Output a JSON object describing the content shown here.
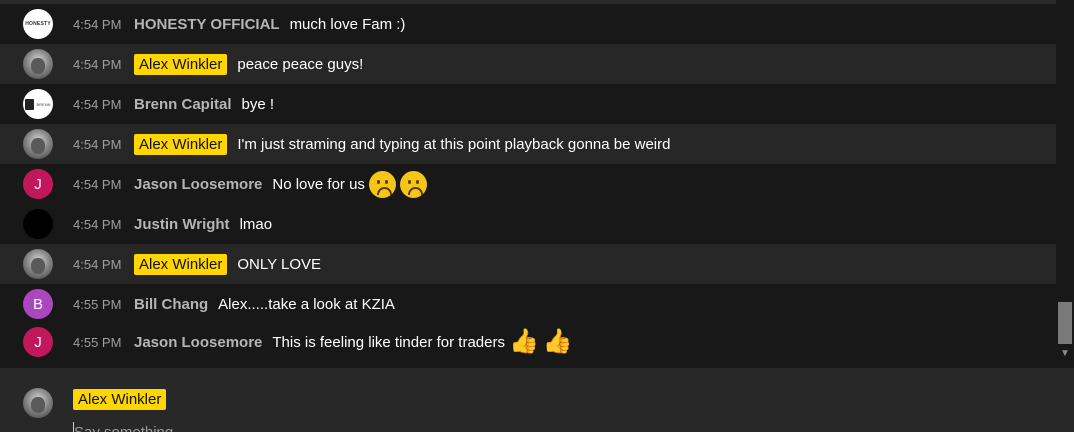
{
  "messages": [
    {
      "time": "4:54 PM",
      "author": "HONESTY OFFICIAL",
      "text": "much love Fam :)",
      "avatar": "honesty-logo",
      "owner": false,
      "emojis": []
    },
    {
      "time": "4:54 PM",
      "author": "Alex Winkler",
      "text": "peace peace guys!",
      "avatar": "alex-photo",
      "owner": true,
      "emojis": []
    },
    {
      "time": "4:54 PM",
      "author": "Brenn Capital",
      "text": "bye !",
      "avatar": "brenn-logo",
      "owner": false,
      "emojis": []
    },
    {
      "time": "4:54 PM",
      "author": "Alex Winkler",
      "text": "I'm just straming and typing at this point playback gonna be weird",
      "avatar": "alex-photo",
      "owner": true,
      "emojis": []
    },
    {
      "time": "4:54 PM",
      "author": "Jason Loosemore",
      "text": "No love for us",
      "avatar": "J",
      "owner": false,
      "emojis": [
        "slightly-frowning-face",
        "slightly-frowning-face"
      ]
    },
    {
      "time": "4:54 PM",
      "author": "Justin Wright",
      "text": "lmao",
      "avatar": "black-circle",
      "owner": false,
      "emojis": []
    },
    {
      "time": "4:54 PM",
      "author": "Alex Winkler",
      "text": "ONLY LOVE",
      "avatar": "alex-photo",
      "owner": true,
      "emojis": []
    },
    {
      "time": "4:55 PM",
      "author": "Bill Chang",
      "text": "Alex.....take a look at KZIA",
      "avatar": "B",
      "owner": false,
      "emojis": []
    },
    {
      "time": "4:55 PM",
      "author": "Jason Loosemore",
      "text": "This is feeling like tinder for traders",
      "avatar": "J",
      "owner": false,
      "emojis": [
        "thumbs-up",
        "thumbs-up"
      ]
    }
  ],
  "avatars": {
    "honesty_text": "HONESTY",
    "brenn_text": "BRENN",
    "jason_initial": "J",
    "bill_initial": "B"
  },
  "composer": {
    "author": "Alex Winkler",
    "placeholder": "Say something..."
  },
  "colors": {
    "background": "#181818",
    "alt_row": "#272727",
    "owner_badge": "#ffd600",
    "jason_avatar": "#c2185b",
    "bill_avatar": "#ab47bc"
  },
  "scroll": {
    "position": 0.85
  }
}
